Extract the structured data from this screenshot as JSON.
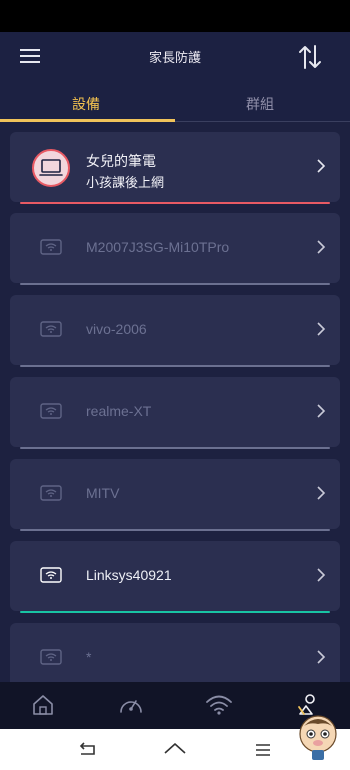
{
  "header": {
    "title": "家長防護"
  },
  "tabs": [
    {
      "label": "設備"
    },
    {
      "label": "群組"
    }
  ],
  "devices": [
    {
      "name": "女兒的筆電",
      "subtitle": "小孩課後上網"
    },
    {
      "name": "M2007J3SG-Mi10TPro"
    },
    {
      "name": "vivo-2006"
    },
    {
      "name": "realme-XT"
    },
    {
      "name": "MITV"
    },
    {
      "name": "Linksys40921"
    },
    {
      "name": "*"
    }
  ],
  "colors": {
    "accent_yellow": "#f0c35a",
    "red": "#e85a64",
    "green": "#19c4a4",
    "card_bg": "#2b2f50"
  },
  "icons": [
    "menu-icon",
    "sort-icon",
    "laptop-icon",
    "wifi-icon",
    "chevron-right-icon",
    "home-icon",
    "speedometer-icon",
    "wifi-nav-icon",
    "parental-icon",
    "back-icon",
    "home-sys-icon",
    "recents-icon"
  ]
}
